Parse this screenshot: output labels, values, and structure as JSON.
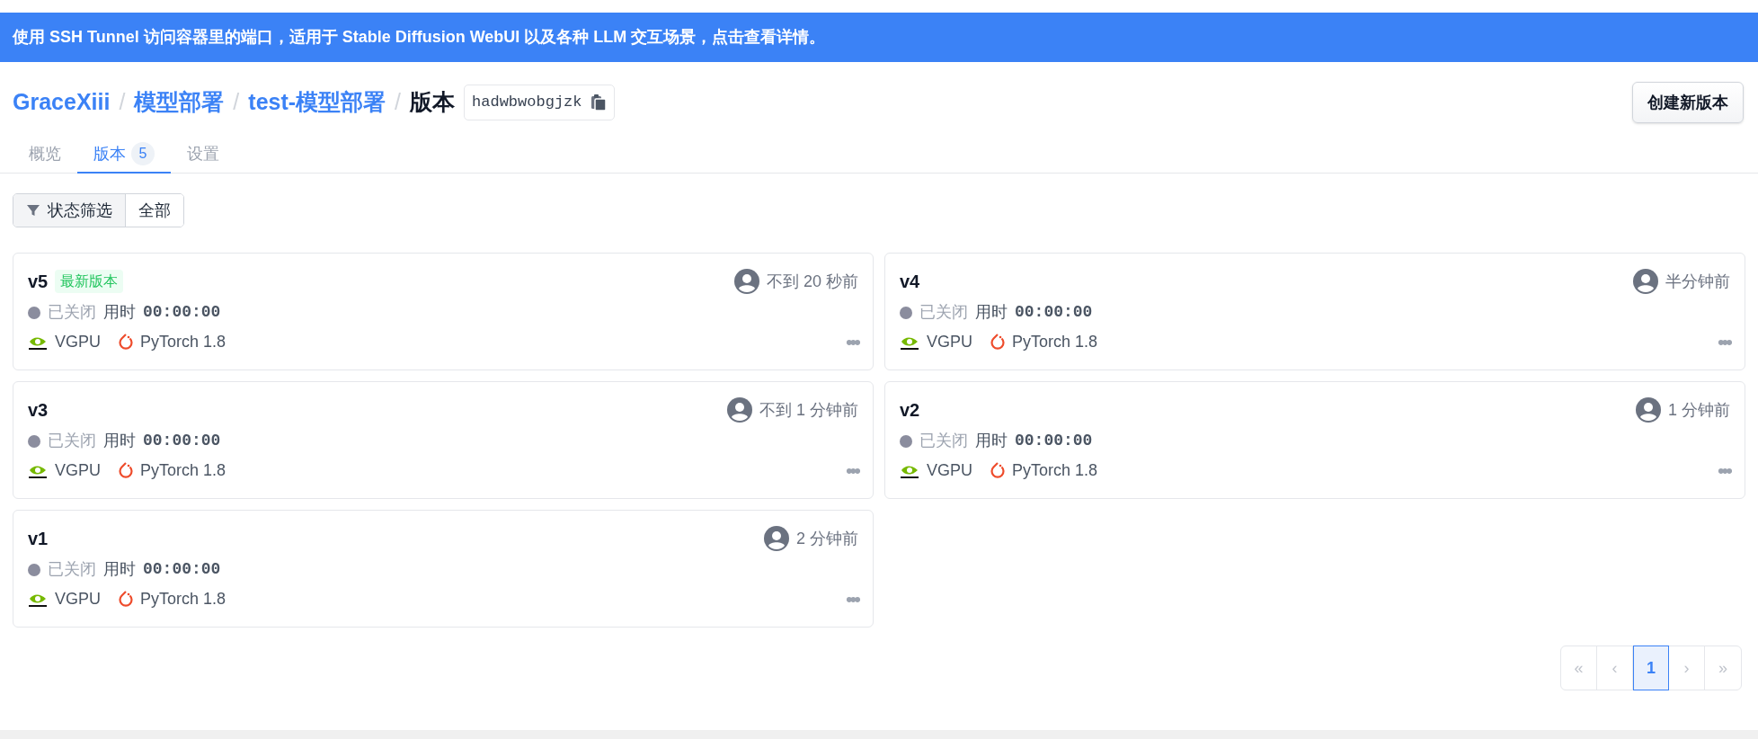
{
  "banner": {
    "text": "使用 SSH Tunnel 访问容器里的端口，适用于 Stable Diffusion WebUI 以及各种 LLM 交互场景，点击查看详情。"
  },
  "breadcrumb": {
    "links": [
      "GraceXiii",
      "模型部署",
      "test-模型部署"
    ],
    "separator": "/",
    "current": "版本",
    "id": "hadwbwobgjzk"
  },
  "create_button": "创建新版本",
  "tabs": [
    {
      "label": "概览",
      "selected": false
    },
    {
      "label": "版本",
      "count": "5",
      "selected": true
    },
    {
      "label": "设置",
      "selected": false
    }
  ],
  "filter": {
    "label": "状态筛选",
    "value": "全部"
  },
  "versions": [
    {
      "name": "v5",
      "badge": "最新版本",
      "time": "不到 20 秒前",
      "status": "已关闭",
      "duration_label": "用时",
      "duration": "00:00:00",
      "gpu": "VGPU",
      "framework": "PyTorch 1.8",
      "menu": "•••"
    },
    {
      "name": "v4",
      "time": "半分钟前",
      "status": "已关闭",
      "duration_label": "用时",
      "duration": "00:00:00",
      "gpu": "VGPU",
      "framework": "PyTorch 1.8",
      "menu": "•••"
    },
    {
      "name": "v3",
      "time": "不到 1 分钟前",
      "status": "已关闭",
      "duration_label": "用时",
      "duration": "00:00:00",
      "gpu": "VGPU",
      "framework": "PyTorch 1.8",
      "menu": "•••"
    },
    {
      "name": "v2",
      "time": "1 分钟前",
      "status": "已关闭",
      "duration_label": "用时",
      "duration": "00:00:00",
      "gpu": "VGPU",
      "framework": "PyTorch 1.8",
      "menu": "•••"
    },
    {
      "name": "v1",
      "time": "2 分钟前",
      "status": "已关闭",
      "duration_label": "用时",
      "duration": "00:00:00",
      "gpu": "VGPU",
      "framework": "PyTorch 1.8",
      "menu": "•••"
    }
  ],
  "pagination": {
    "first": "«",
    "prev": "‹",
    "pages": [
      {
        "label": "1",
        "selected": true
      }
    ],
    "next": "›",
    "last": "»"
  }
}
